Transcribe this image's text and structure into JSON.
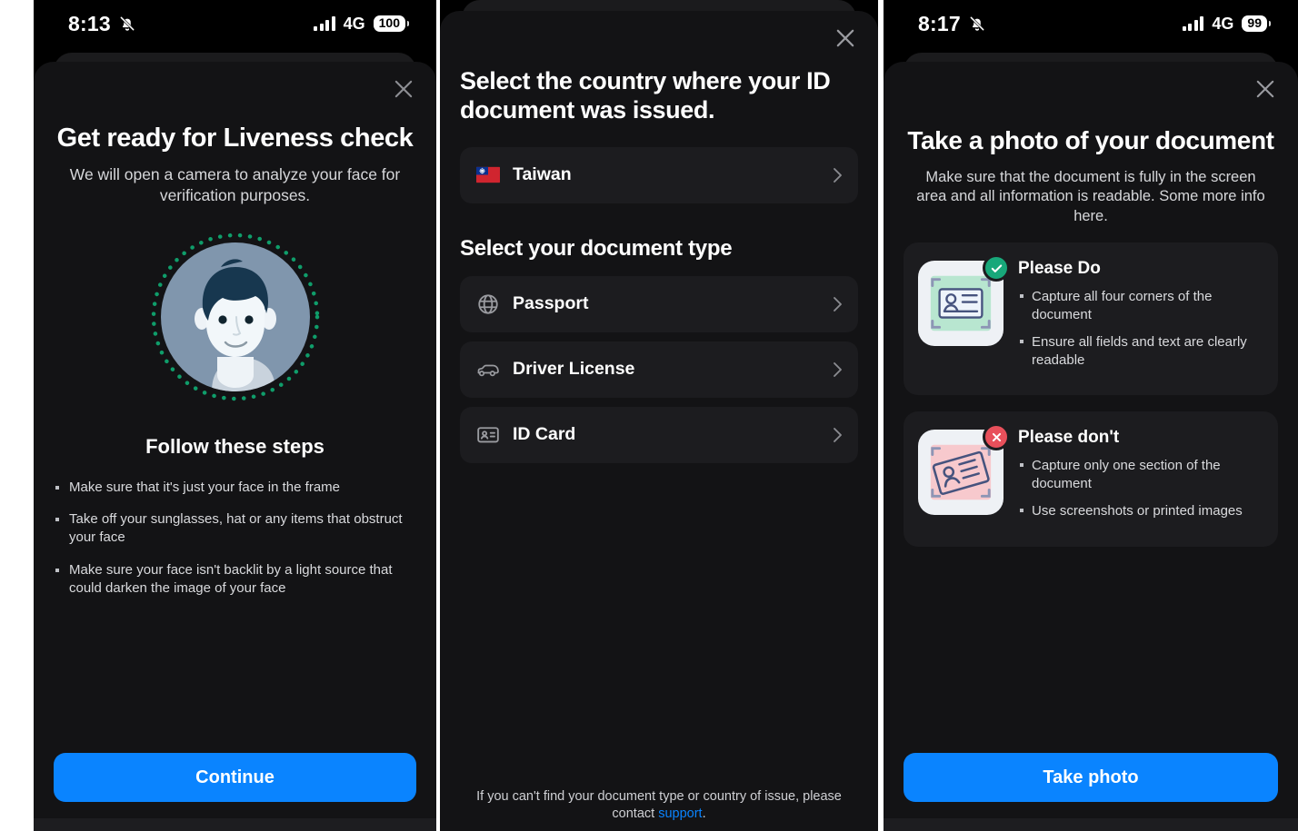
{
  "panels": [
    {
      "status": {
        "time": "8:13",
        "mute_icon": "bell-slash-icon",
        "network": "4G",
        "battery": "100"
      },
      "close_label": "×",
      "title": "Get ready for Liveness check",
      "subtitle": "We will open a camera to analyze your face for verification purposes.",
      "avatar_icon": "face-avatar-icon",
      "steps_title": "Follow these steps",
      "steps": [
        "Make sure that it's just your face in the frame",
        "Take off your sunglasses, hat or any items that obstruct your face",
        "Make sure your face isn't backlit by a light source that could darken the image of your face"
      ],
      "cta": "Continue"
    },
    {
      "close_label": "×",
      "title": "Select the country where your ID document was issued.",
      "country": {
        "flag": "🇹🇼",
        "name": "Taiwan",
        "icon": "taiwan-flag-icon"
      },
      "section_title": "Select your document type",
      "documents": [
        {
          "label": "Passport",
          "icon": "globe-icon"
        },
        {
          "label": "Driver License",
          "icon": "car-icon"
        },
        {
          "label": "ID Card",
          "icon": "id-card-icon"
        }
      ],
      "footnote_text": "If you can't find your document type or country of issue, please contact ",
      "footnote_link": "support",
      "footnote_end": "."
    },
    {
      "status": {
        "time": "8:17",
        "mute_icon": "bell-slash-icon",
        "network": "4G",
        "battery": "99"
      },
      "close_label": "×",
      "title": "Take a photo of your document",
      "subtitle": "Make sure that the document is fully in the screen area and all information is readable. Some more info here.",
      "tips": [
        {
          "heading": "Please Do",
          "badge": "check-icon",
          "thumb": "id-card-good-icon",
          "items": [
            "Capture all four corners of the document",
            "Ensure all fields and text are clearly readable"
          ]
        },
        {
          "heading": "Please don't",
          "badge": "x-icon",
          "thumb": "id-card-bad-icon",
          "items": [
            "Capture only one section of the document",
            "Use screenshots or printed images"
          ]
        }
      ],
      "cta": "Take photo"
    }
  ],
  "colors": {
    "accent_blue": "#0a84ff",
    "success_green": "#18a87a",
    "error_red": "#e8505b",
    "sheet_bg": "#131315",
    "row_bg": "#1c1c1f",
    "avatar_bg": "#8096ad",
    "ring_green": "#0f9d6a"
  }
}
